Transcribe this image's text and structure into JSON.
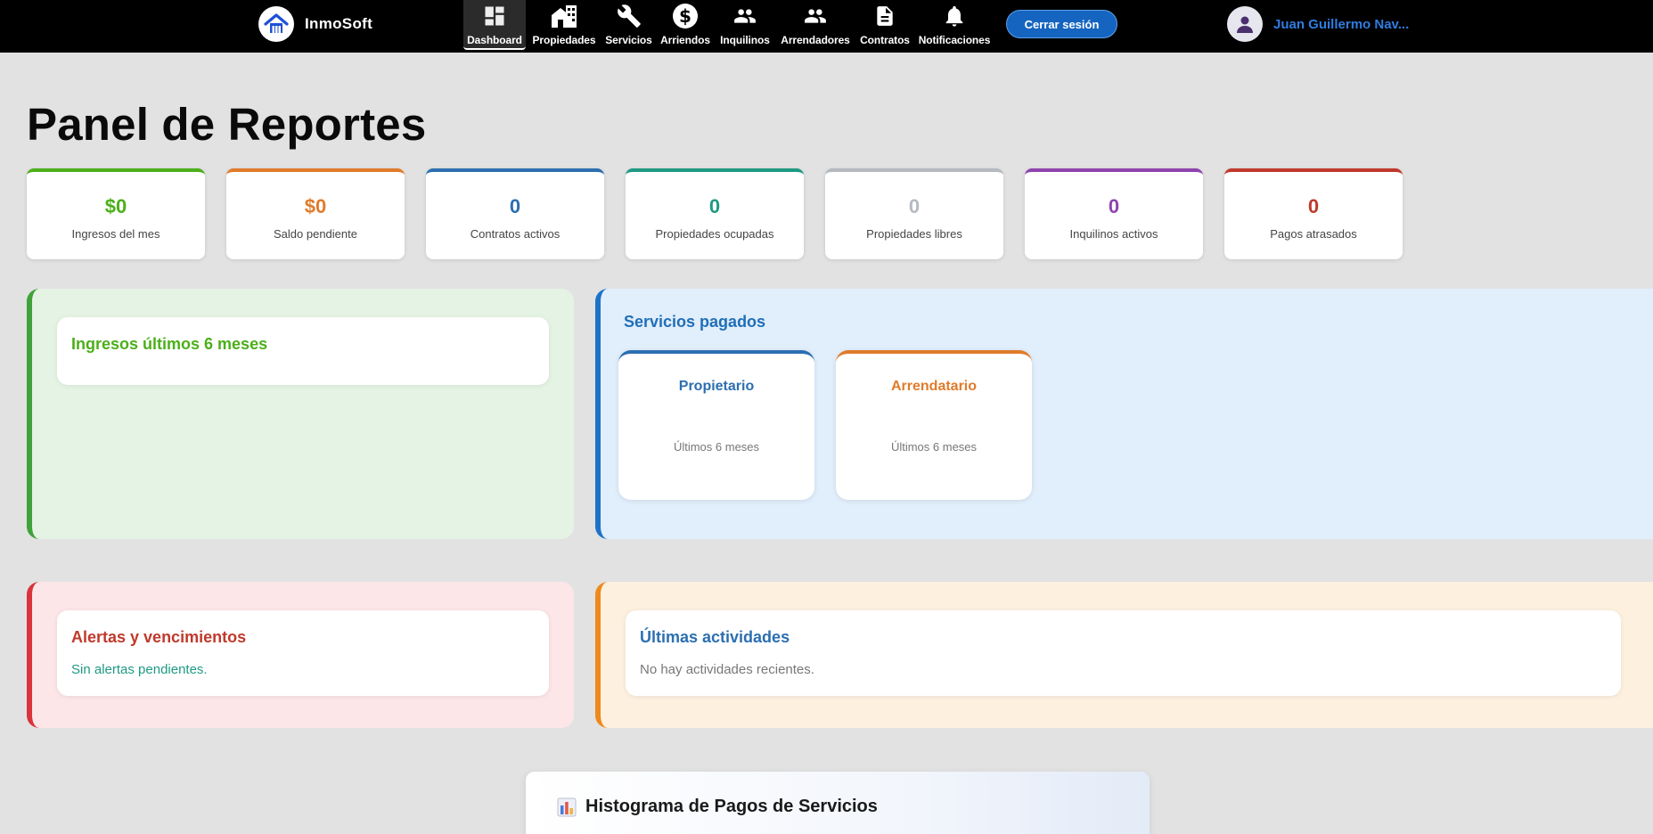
{
  "brand": {
    "name": "InmoSoft",
    "icon": "house-logo-icon"
  },
  "nav": {
    "items": [
      {
        "label": "Dashboard",
        "icon": "dashboard-icon",
        "active": true
      },
      {
        "label": "Propiedades",
        "icon": "building-icon"
      },
      {
        "label": "Servicios",
        "icon": "wrench-icon"
      },
      {
        "label": "Arriendos",
        "icon": "dollar-icon"
      },
      {
        "label": "Inquilinos",
        "icon": "people-icon"
      },
      {
        "label": "Arrendadores",
        "icon": "people-icon"
      },
      {
        "label": "Contratos",
        "icon": "document-icon"
      },
      {
        "label": "Notificaciones",
        "icon": "bell-icon"
      }
    ],
    "logout_label": "Cerrar sesión",
    "user_name": "Juan Guillermo Nav..."
  },
  "page": {
    "title": "Panel de Reportes"
  },
  "stats": [
    {
      "value": "$0",
      "label": "Ingresos del mes",
      "color": "#4caf1a"
    },
    {
      "value": "$0",
      "label": "Saldo pendiente",
      "color": "#e07b2a"
    },
    {
      "value": "0",
      "label": "Contratos activos",
      "color": "#2c6fb0"
    },
    {
      "value": "0",
      "label": "Propiedades ocupadas",
      "color": "#1f9a82"
    },
    {
      "value": "0",
      "label": "Propiedades libres",
      "color": "#b5b9c0"
    },
    {
      "value": "0",
      "label": "Inquilinos activos",
      "color": "#8e44ad"
    },
    {
      "value": "0",
      "label": "Pagos atrasados",
      "color": "#c0392b"
    }
  ],
  "income_panel": {
    "title": "Ingresos últimos 6 meses",
    "accent": "#4caf1a"
  },
  "services_panel": {
    "title": "Servicios pagados",
    "cards": [
      {
        "title": "Propietario",
        "subtitle": "Últimos 6 meses",
        "color": "#2c6fb0"
      },
      {
        "title": "Arrendatario",
        "subtitle": "Últimos 6 meses",
        "color": "#e07b2a"
      }
    ]
  },
  "alerts_panel": {
    "title": "Alertas y vencimientos",
    "message": "Sin alertas pendientes."
  },
  "activity_panel": {
    "title": "Últimas actividades",
    "message": "No hay actividades recientes."
  },
  "histogram": {
    "title": "Histograma de Pagos de Servicios",
    "icon": "bar-chart-icon"
  }
}
